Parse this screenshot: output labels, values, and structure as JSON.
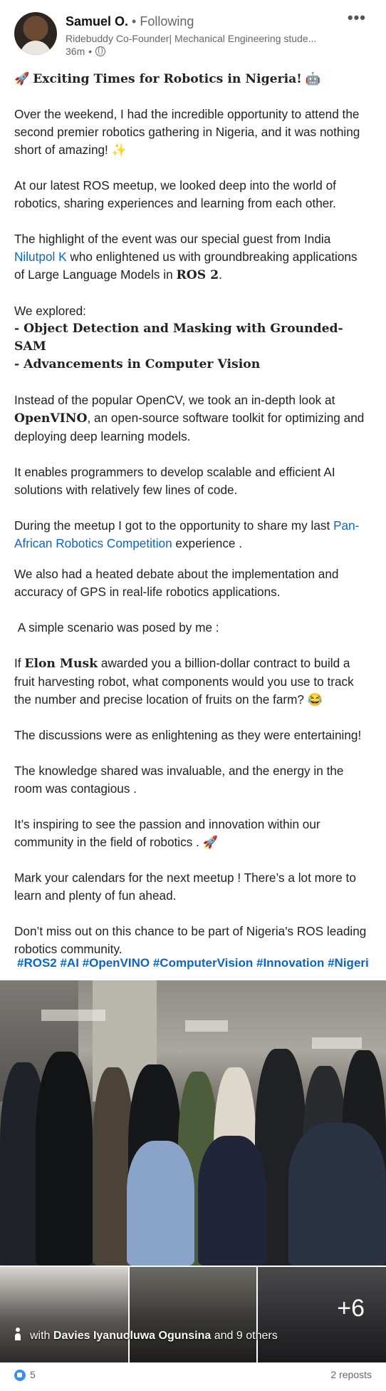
{
  "author": {
    "name": "Samuel O.",
    "separator": "•",
    "following": "Following",
    "headline": "Ridebuddy Co-Founder| Mechanical Engineering stude...",
    "time": "36m",
    "time_separator": "•"
  },
  "post": {
    "title_emoji_start": "🚀",
    "title": "Exciting Times for Robotics in Nigeria!",
    "title_emoji_end": "🤖",
    "p1": "Over the weekend, I had the incredible opportunity to attend the second premier robotics gathering in Nigeria, and it was nothing short of amazing!",
    "p1_emoji": "✨",
    "p2": "At our latest ROS meetup, we looked deep into the world of robotics, sharing experiences and learning from each other.",
    "p3_before": "The highlight of the event was our special guest from India",
    "p3_guest": "Nilutpol K",
    "p3_middle": "who enlightened us with groundbreaking applications of Large Language Models in",
    "p3_ros": "ROS 2",
    "p3_end": ".",
    "explored_label": "We explored:",
    "explored_1": "- Object Detection and Masking with Grounded-SAM",
    "explored_2": "- Advancements in Computer Vision",
    "p4_before": "Instead of the popular OpenCV, we took an in-depth look at",
    "p4_openvino": "OpenVINO",
    "p4_after": ", an open-source software toolkit for optimizing and deploying deep learning models.",
    "p5": "It enables programmers to develop scalable and efficient AI solutions with relatively few lines of code.",
    "p6_before": "During the meetup I got to the opportunity to share my last",
    "p6_link": "Pan-African Robotics Competition",
    "p6_after": "experience .",
    "p7": "We also had a heated debate about the implementation and accuracy of GPS in real-life robotics applications.",
    "p8": " A simple scenario was posed by me :",
    "p9_before": "If",
    "p9_name": "Elon Musk",
    "p9_after": "awarded you a billion-dollar contract to build a fruit harvesting robot, what components would you use to track the number and precise location of fruits on the farm?",
    "p9_emoji": "😂",
    "p10": "The discussions were as enlightening as they were entertaining!",
    "p11": "The knowledge shared was invaluable, and the energy in the room was contagious .",
    "p12": "It’s inspiring to see the passion and innovation within our community in the field of robotics .",
    "p12_emoji": "🚀",
    "p13": "Mark your calendars for the next meetup ! There’s a lot more to learn and plenty of fun ahead.",
    "p14": "Don’t miss out on this chance to be part of Nigeria's ROS leading robotics community.",
    "hashtags": "#ROS2 #AI #OpenVINO #ComputerVision #Innovation #Nigeri"
  },
  "media": {
    "more_photos": "+6",
    "tag_prefix": "with",
    "tag_person": "Davies Iyanuoluwa Ogunsina",
    "tag_suffix": "and 9 others"
  },
  "footer": {
    "reactions": "5",
    "reposts": "2 reposts"
  },
  "colors": {
    "link": "#0a66c2",
    "reaction": "#378fe9"
  }
}
